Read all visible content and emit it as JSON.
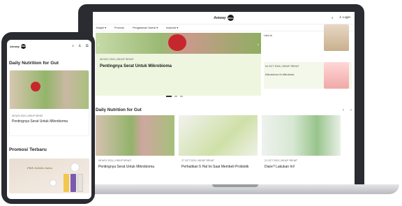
{
  "brand": {
    "word": "Amway",
    "mark": "AMWAY"
  },
  "laptop": {
    "header": {
      "search_icon": "search-icon",
      "login_label": "Login"
    },
    "nav": [
      "Jelajah ▾",
      "Promosi",
      "Pengalaman Nutrisi ▾",
      "Inspirasi ▾"
    ],
    "hero": {
      "date": "08 NOV 2024  |  HIDUP SEHAT",
      "title": "Pentingnya Serat Untuk Mikrobioma"
    },
    "side": [
      {
        "text": "Usia lia"
      },
      {
        "text": "04 OCT 2024  |  HIDUP SEHAT"
      },
      {
        "text": "Mikrobioma Vs Mikrobiota"
      }
    ],
    "section_title": "Daily Nutrition for Gut",
    "cards": [
      {
        "meta": "08 NOV 2024  |  HIDUP SEHAT",
        "title": "Pentingnya Serat Untuk Mikrobioma"
      },
      {
        "meta": "27 OCT 2024  |  HIDUP SEHAT",
        "title": "Perhatikan 5 Hal Ini Saat Membeli Probiotik"
      },
      {
        "meta": "21 OCT 2024  |  HIDUP SEHAT",
        "title": "Diare? Lakukan Ini!"
      }
    ]
  },
  "phone": {
    "section_title": "Daily Nutrition for Gut",
    "card": {
      "meta": "08 NOV 2024  |  HIDUP SEHAT",
      "title": "Pentingnya Serat Untuk Mikrobioma"
    },
    "promo_title": "Promosi Terbaru",
    "promo_script": "Pilih Sekilis Sales"
  },
  "colors": {
    "accent": "#1b1b1b",
    "hero_bg": "#eef6df",
    "red": "#c8262d"
  }
}
